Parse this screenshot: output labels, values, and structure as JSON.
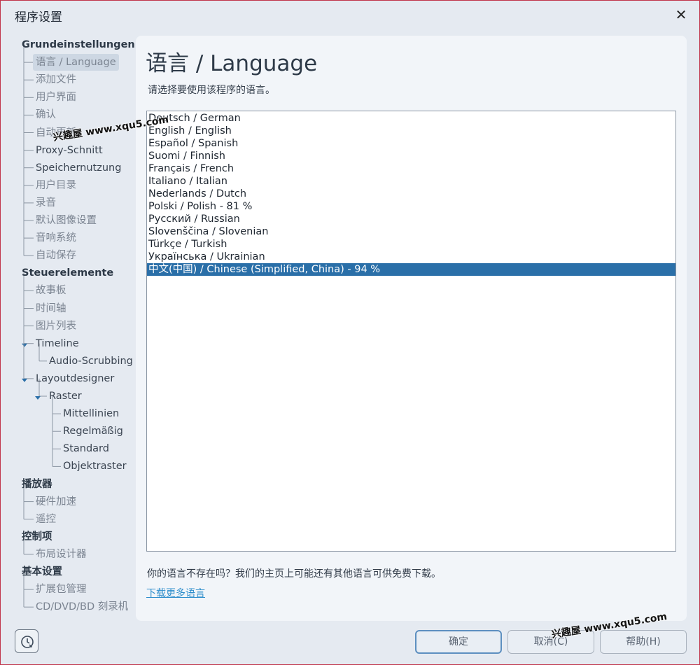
{
  "window": {
    "title": "程序设置"
  },
  "sidebar": {
    "rows": [
      {
        "label": "Grundeinstellungen",
        "kind": "header"
      },
      {
        "label": "语言 / Language",
        "kind": "item",
        "selected": true
      },
      {
        "label": "添加文件",
        "kind": "item"
      },
      {
        "label": "用户界面",
        "kind": "item"
      },
      {
        "label": "确认",
        "kind": "item"
      },
      {
        "label": "自动更新",
        "kind": "item"
      },
      {
        "label": "Proxy-Schnitt",
        "kind": "item"
      },
      {
        "label": "Speichernutzung",
        "kind": "item"
      },
      {
        "label": "用户目录",
        "kind": "item"
      },
      {
        "label": "录音",
        "kind": "item"
      },
      {
        "label": "默认图像设置",
        "kind": "item"
      },
      {
        "label": "音响系统",
        "kind": "item"
      },
      {
        "label": "自动保存",
        "kind": "item"
      },
      {
        "label": "Steuerelemente",
        "kind": "header"
      },
      {
        "label": "故事板",
        "kind": "item"
      },
      {
        "label": "时间轴",
        "kind": "item"
      },
      {
        "label": "图片列表",
        "kind": "item"
      },
      {
        "label": "Timeline",
        "kind": "item",
        "expanded": true
      },
      {
        "label": "Audio-Scrubbing",
        "kind": "item"
      },
      {
        "label": "Layoutdesigner",
        "kind": "item",
        "expanded": true
      },
      {
        "label": "Raster",
        "kind": "item",
        "expanded": true
      },
      {
        "label": "Mittellinien",
        "kind": "item"
      },
      {
        "label": "Regelmäßig",
        "kind": "item"
      },
      {
        "label": "Standard",
        "kind": "item"
      },
      {
        "label": "Objektraster",
        "kind": "item"
      },
      {
        "label": "播放器",
        "kind": "header"
      },
      {
        "label": "硬件加速",
        "kind": "item"
      },
      {
        "label": "遥控",
        "kind": "item"
      },
      {
        "label": "控制项",
        "kind": "header"
      },
      {
        "label": "布局设计器",
        "kind": "item"
      },
      {
        "label": "基本设置",
        "kind": "header"
      },
      {
        "label": "扩展包管理",
        "kind": "item"
      },
      {
        "label": "CD/DVD/BD 刻录机",
        "kind": "item"
      }
    ]
  },
  "main": {
    "title": "语言 / Language",
    "description": "请选择要使用该程序的语言。",
    "languages": [
      "Deutsch / German",
      "English / English",
      "Español / Spanish",
      "Suomi / Finnish",
      "Français / French",
      "Italiano / Italian",
      "Nederlands / Dutch",
      "Polski / Polish  -  81 %",
      "Русский / Russian",
      "Slovenščina / Slovenian",
      "Türkçe / Turkish",
      "Українська / Ukrainian",
      "中文(中国) / Chinese (Simplified, China)  -  94 %"
    ],
    "selected_index": 12,
    "note": "你的语言不存在吗？我们的主页上可能还有其他语言可供免费下载。",
    "link": "下载更多语言"
  },
  "buttons": {
    "ok": "确定",
    "cancel": "取消(C)",
    "help": "帮助(H)"
  },
  "watermarks": {
    "top": "兴趣屋 www.xqu5.com",
    "bottom": "兴趣屋 www.xqu5.com"
  },
  "icons": {
    "close": "close-icon",
    "help": "clock-help-icon"
  },
  "colors": {
    "selection": "#2a6fa8",
    "link": "#2f8ecc",
    "window_border": "#c0334a"
  }
}
